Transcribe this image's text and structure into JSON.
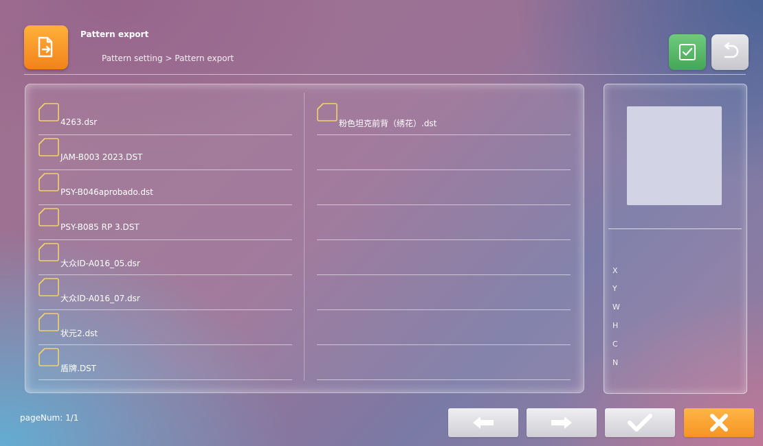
{
  "header": {
    "title": "Pattern export",
    "breadcrumb": "Pattern setting > Pattern export",
    "app_icon": "file-export-icon"
  },
  "files": {
    "left_column": [
      "4263.dsr",
      "JAM-B003 2023.DST",
      "PSY-B046aprobado.dst",
      "PSY-B085 RP 3.DST",
      "大众ID-A016_05.dsr",
      "大众ID-A016_07.dsr",
      "状元2.dst",
      "盾牌.DST"
    ],
    "right_column": [
      "粉色坦克前背（绣花）.dst",
      "",
      "",
      "",
      "",
      "",
      "",
      ""
    ]
  },
  "preview": {
    "labels": [
      "X",
      "Y",
      "W",
      "H",
      "C",
      "N"
    ]
  },
  "footer": {
    "page_num": "pageNum: 1/1"
  },
  "colors": {
    "accent_orange": "#f59523",
    "confirm_green": "#45a657",
    "folder_gold": "#f1d36b"
  }
}
